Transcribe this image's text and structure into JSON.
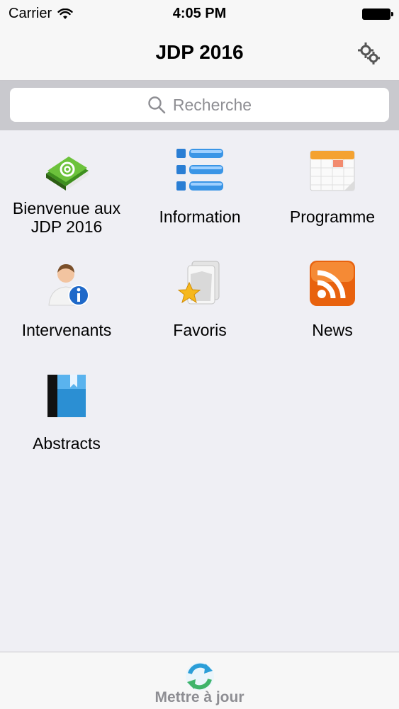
{
  "status_bar": {
    "carrier": "Carrier",
    "time": "4:05 PM"
  },
  "nav": {
    "title": "JDP 2016",
    "settings_icon": "gear-icon"
  },
  "search": {
    "placeholder": "Recherche"
  },
  "tiles": [
    {
      "label": "Bienvenue aux JDP 2016",
      "icon": "book-at-icon"
    },
    {
      "label": "Information",
      "icon": "list-icon"
    },
    {
      "label": "Programme",
      "icon": "calendar-icon"
    },
    {
      "label": "Intervenants",
      "icon": "user-info-icon"
    },
    {
      "label": "Favoris",
      "icon": "star-folder-icon"
    },
    {
      "label": "News",
      "icon": "rss-icon"
    },
    {
      "label": "Abstracts",
      "icon": "bookmark-book-icon"
    }
  ],
  "tabbar": {
    "update_label": "Mettre à jour",
    "icon": "refresh-icon"
  },
  "colors": {
    "background": "#efeff4",
    "navbar": "#f7f7f7",
    "search_bg": "#c9c9ce",
    "placeholder": "#8e8e93"
  }
}
